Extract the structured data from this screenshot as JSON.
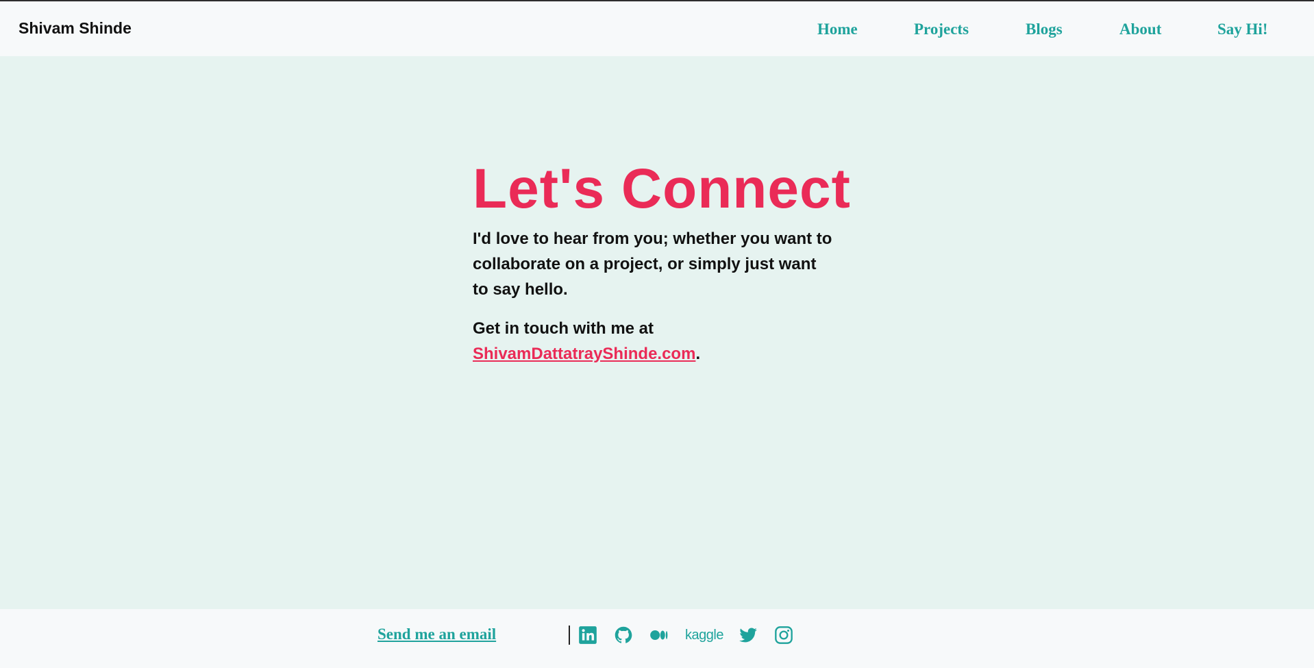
{
  "header": {
    "brand": "Shivam Shinde",
    "nav": [
      "Home",
      "Projects",
      "Blogs",
      "About",
      "Say Hi!"
    ]
  },
  "main": {
    "heading": "Let's Connect",
    "intro": "I'd love to hear from you; whether you want to collaborate on a project, or simply just want to say hello.",
    "touch_prefix": "Get in touch with me at",
    "touch_link": "ShivamDattatrayShinde.com",
    "touch_suffix": "."
  },
  "footer": {
    "email_link": "Send me an email",
    "socials": [
      {
        "icon": "linkedin-icon"
      },
      {
        "icon": "github-icon"
      },
      {
        "icon": "medium-icon"
      },
      {
        "icon": "kaggle-icon",
        "label": "kaggle"
      },
      {
        "icon": "twitter-icon"
      },
      {
        "icon": "instagram-icon"
      }
    ]
  },
  "colors": {
    "background": "#e6f3f0",
    "bar_background": "#f7f9fa",
    "accent_teal": "#1fa39c",
    "accent_pink": "#ea2b57",
    "text": "#111111"
  }
}
